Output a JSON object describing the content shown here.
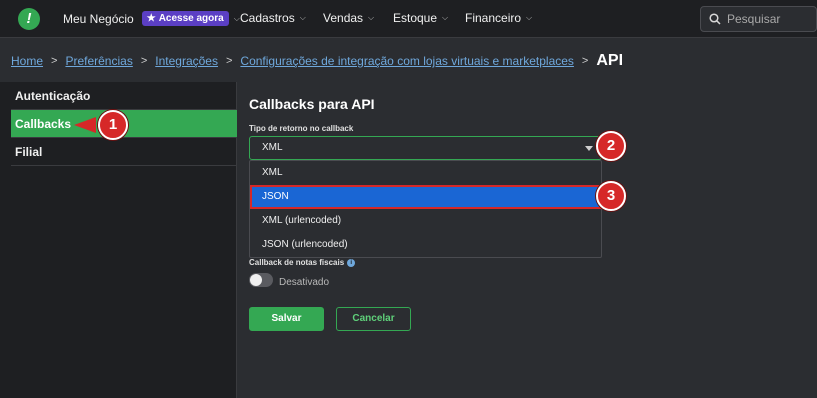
{
  "topbar": {
    "logo_glyph": "!",
    "business": "Meu Negócio",
    "badge": "Acesse agora",
    "nav": [
      "Cadastros",
      "Vendas",
      "Estoque",
      "Financeiro"
    ],
    "search_placeholder": "Pesquisar"
  },
  "breadcrumb": {
    "items": [
      "Home",
      "Preferências",
      "Integrações",
      "Configurações de integração com lojas virtuais e marketplaces"
    ],
    "current": "API"
  },
  "sidebar": {
    "items": [
      "Autenticação",
      "Callbacks",
      "Filial"
    ],
    "active": "Callbacks"
  },
  "main": {
    "title": "Callbacks para API",
    "field_label": "Tipo de retorno no callback",
    "selected": "XML",
    "options": [
      "XML",
      "JSON",
      "XML (urlencoded)",
      "JSON (urlencoded)"
    ],
    "highlighted_option": "JSON",
    "callback_label": "Callback de notas fiscais",
    "toggle_label": "Desativado",
    "toggle_on": false,
    "save_label": "Salvar",
    "cancel_label": "Cancelar"
  },
  "markers": [
    "1",
    "2",
    "3"
  ],
  "colors": {
    "accent": "#34a853",
    "highlight": "#1a66d4",
    "marker": "#d62828",
    "badge": "#5b3fc4",
    "link": "#6fa8dc"
  }
}
